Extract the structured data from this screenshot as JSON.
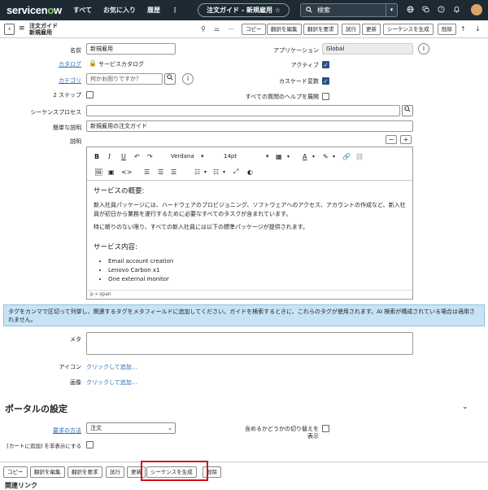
{
  "nav": {
    "logo_a": "servicen",
    "logo_o": "o",
    "logo_b": "w",
    "links": [
      "すべて",
      "お気に入り",
      "履歴"
    ],
    "more": "⋮",
    "context_pill": "注文ガイド - 新規雇用 ☆",
    "search_placeholder": "検索",
    "icons": [
      "globe-icon",
      "chat-icon",
      "help-icon",
      "bell-icon"
    ]
  },
  "header": {
    "line1": "注文ガイド",
    "line2": "新規雇用",
    "buttons": [
      "コピー",
      "翻訳を編集",
      "翻訳を要求",
      "試行",
      "更新",
      "シーケンスを生成",
      "削除"
    ]
  },
  "form": {
    "name_label": "名前",
    "name_value": "新規雇用",
    "catalog_label": "カタログ",
    "catalog_value": "サービスカタログ",
    "category_label": "カテゴリ",
    "category_placeholder": "何かお困りですか？",
    "two_step_label": "2 ステップ",
    "app_label": "アプリケーション",
    "app_value": "Global",
    "active_label": "アクティブ",
    "cascade_label": "カスケード変数",
    "expand_help_label": "すべての質問のヘルプを展開",
    "sequence_label": "シーケンスプロセス",
    "short_desc_label": "簡単な説明",
    "short_desc_value": "新規雇用の注文ガイド",
    "desc_label": "説明",
    "meta_label": "メタ",
    "icon_label": "アイコン",
    "icon_link": "クリックして追加...",
    "image_label": "画像",
    "image_link": "クリックして追加..."
  },
  "editor": {
    "font": "Verdana",
    "size": "14pt",
    "heading1": "サービスの概要:",
    "para1": "新入社員パッケージには、ハードウェアのプロビジョニング、ソフトウェアへのアクセス、アカウントの作成など、新入社員が初日から業務を遂行するために必要なすべてのタスクが含まれています。",
    "para2": "特に断りのない限り、すべての新入社員には以下の標準パッケージが提供されます。",
    "heading2": "サービス内容:",
    "items": [
      "Email account creation",
      "Lenovo Carbon x1",
      "One external monitor"
    ],
    "status": "p » span"
  },
  "info_text": "タグをカンマで区切って列挙し、関連するタグをメタフィールドに追加してください。ガイドを検索するときに、これらのタグが使用されます。AI 検索が構成されている場合は適用されません。",
  "portal": {
    "title": "ポータルの設定",
    "request_method_label": "要求の方法",
    "request_method_value": "注文",
    "hide_cart_label": "[カートに追加] を非表示にする",
    "include_toggle_label": "含めるかどうかの切り替えを表示"
  },
  "bottom_buttons": [
    "コピー",
    "翻訳を編集",
    "翻訳を要求",
    "試行",
    "更新",
    "シーケンスを生成",
    "削除"
  ],
  "related_links": "関連リンク",
  "colors": {
    "nav_bg": "#1d2a33",
    "accent_green": "#7fd36b",
    "info_bg": "#c7e4f5",
    "highlight_red": "#d0121b"
  }
}
